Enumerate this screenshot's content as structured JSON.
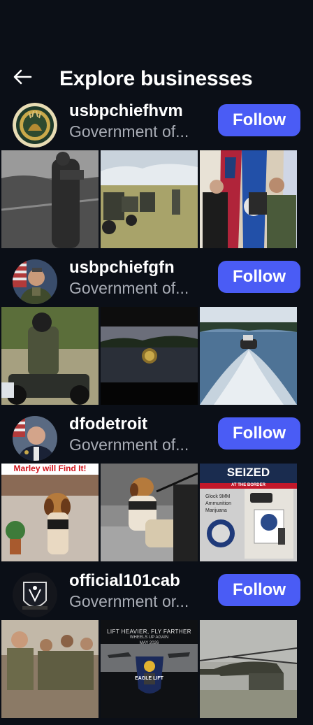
{
  "header": {
    "title": "Explore businesses"
  },
  "follow_label": "Follow",
  "businesses": [
    {
      "username": "usbpchiefhvm",
      "category": "Government of..."
    },
    {
      "username": "usbpchiefgfn",
      "category": "Government of..."
    },
    {
      "username": "dfodetroit",
      "category": "Government of..."
    },
    {
      "username": "official101cab",
      "category": "Government or..."
    }
  ],
  "thumb_text": {
    "marley": "Marley will Find It!",
    "seized": "SEIZED",
    "seized_sub": "AT THE BORDER",
    "seized_list": [
      "Glock 9MM",
      "Ammunition",
      "Marijuana"
    ],
    "lift": "LIFT HEAVIER, FLY FARTHER",
    "wheels": "WHEELS UP AGAIN",
    "date": "MAY 2026",
    "eagle": "EAGLE LIFT"
  },
  "colors": {
    "follow_bg": "#4a5cf5",
    "background": "#0b0f17",
    "secondary_text": "#a9adb6"
  }
}
